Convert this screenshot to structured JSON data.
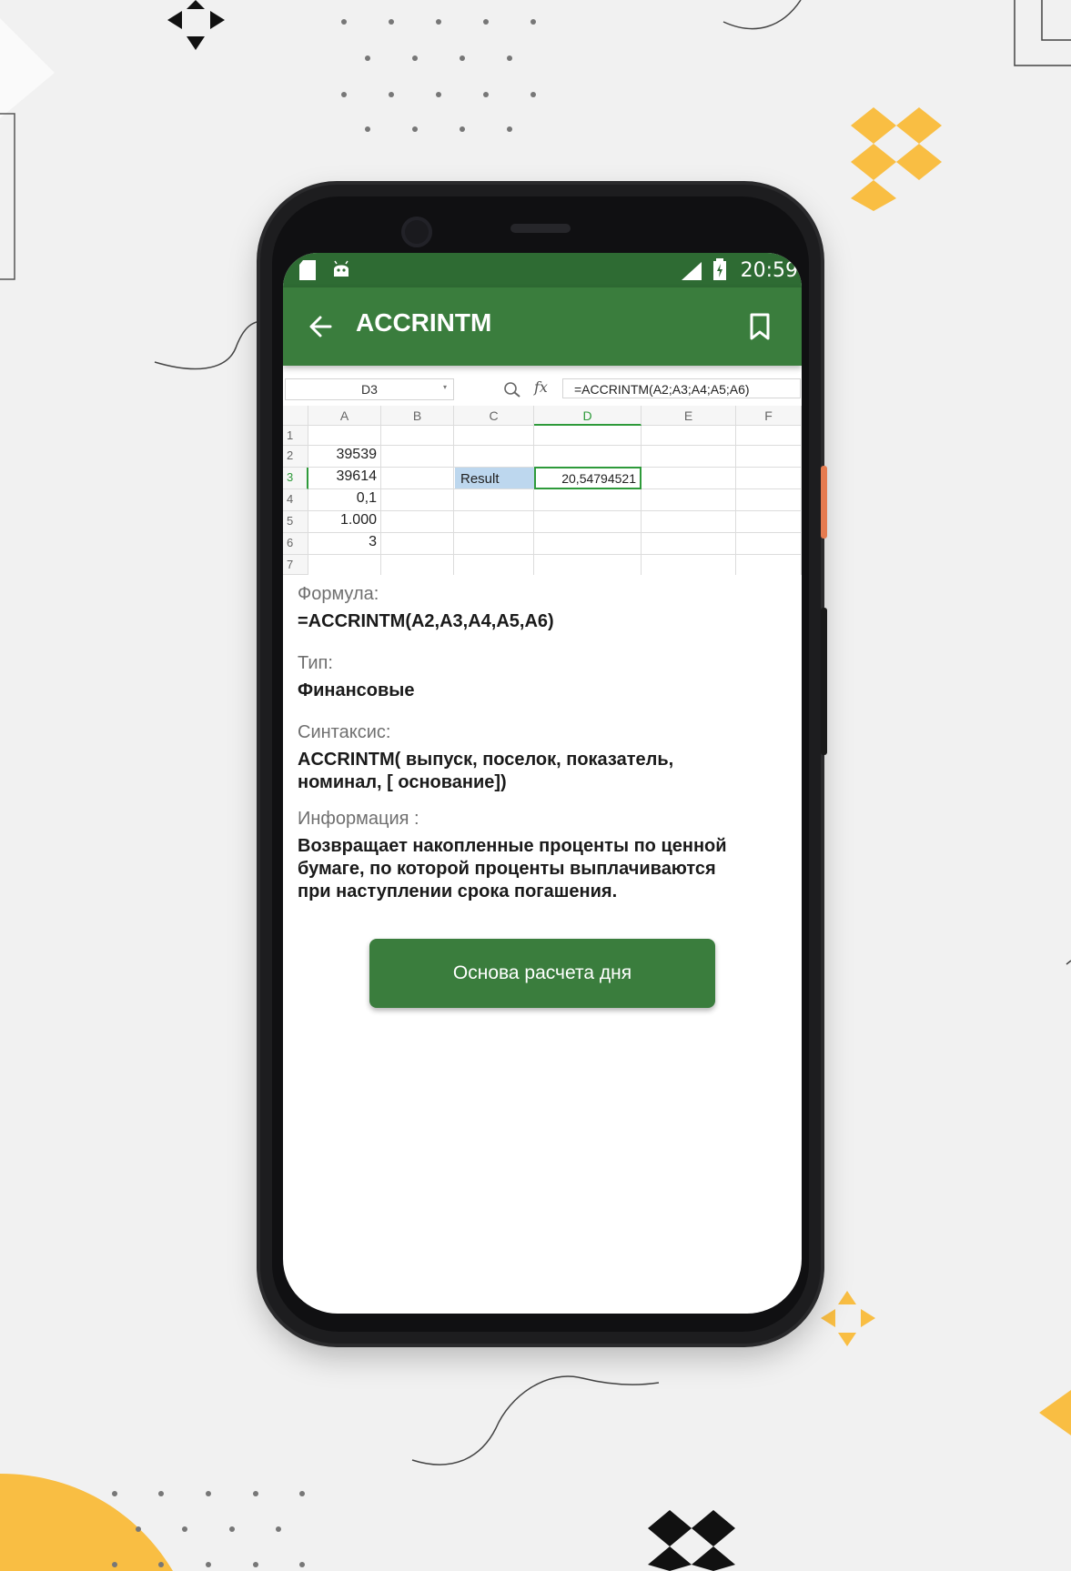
{
  "status_bar": {
    "time": "20:59"
  },
  "app_bar": {
    "title": "ACCRINTM"
  },
  "spreadsheet": {
    "name_box": "D3",
    "formula": "=ACCRINTM(A2;A3;A4;A5;A6)",
    "columns": [
      "A",
      "B",
      "C",
      "D",
      "E",
      "F"
    ],
    "rows": [
      "1",
      "2",
      "3",
      "4",
      "5",
      "6",
      "7"
    ],
    "a_values": {
      "r2": "39539",
      "r3": "39614",
      "r4": "0,1",
      "r5": "1.000",
      "r6": "3"
    },
    "result_label": "Result",
    "result_value": "20,54794521"
  },
  "details": {
    "formula_label": "Формула:",
    "formula_value": "=ACCRINTM(A2,A3,A4,A5,A6)",
    "type_label": "Тип:",
    "type_value": "Финансовые",
    "syntax_label": "Синтаксис:",
    "syntax_value_line1": "ACCRINTM( выпуск,  поселок,  показатель,",
    "syntax_value_line2": "номинал, [ основание])",
    "info_label": "Информация :",
    "info_line1": "Возвращает накопленные проценты по ценной",
    "info_line2": "бумаге, по которой проценты выплачиваются",
    "info_line3": "при наступлении срока погашения."
  },
  "action_button": {
    "label": "Основа расчета дня"
  },
  "colors": {
    "status_bar": "#2e6b33",
    "app_bar": "#3a7d3d",
    "accent_yellow": "#f9be43",
    "result_fill": "#bdd7ee",
    "selection": "#2e9a3a"
  },
  "icons": [
    "sd-card-icon",
    "android-icon",
    "signal-icon",
    "battery-icon",
    "back-arrow-icon",
    "bookmark-icon",
    "zoom-icon"
  ]
}
